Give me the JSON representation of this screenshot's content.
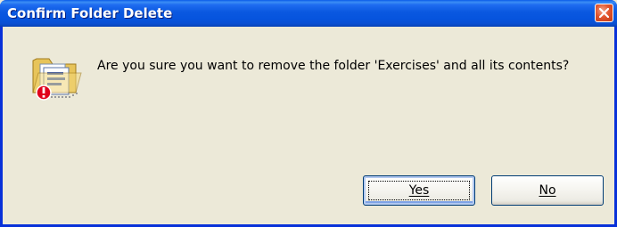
{
  "dialog": {
    "title": "Confirm Folder Delete",
    "message": "Are you sure you want to remove the folder 'Exercises' and all its contents?",
    "buttons": {
      "yes_label": "Yes",
      "no_label": "No"
    },
    "icons": {
      "close": "close-icon",
      "dialog": "folder-delete-warning-icon"
    }
  }
}
